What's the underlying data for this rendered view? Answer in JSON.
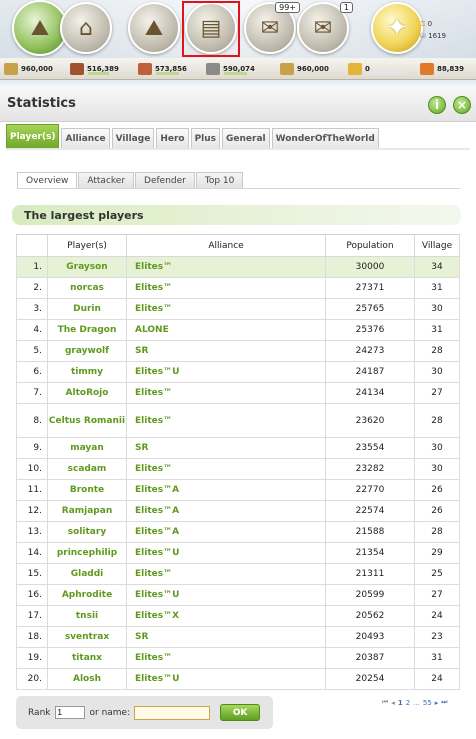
{
  "topbar": {
    "icons": [
      "village-overview-icon",
      "buildings-icon",
      "map-icon",
      "statistics-icon",
      "reports-icon",
      "messages-icon",
      "gold-icon"
    ],
    "reports_badge": "99+",
    "messages_badge": "1",
    "gold": "0",
    "silver": "1619"
  },
  "resources": {
    "culture": "960,000",
    "wood": "516,389",
    "clay": "573,856",
    "iron": "590,074",
    "crop_storage": "960,000",
    "free_crop": "0",
    "crop_prod": "88,839",
    "wood_fill": 0.54,
    "clay_fill": 0.6,
    "iron_fill": 0.61,
    "free_crop_fill": 0.0,
    "colors": {
      "wood": "#a0522d",
      "clay": "#c0603a",
      "iron": "#8a8a8a",
      "crop": "#e2b43a"
    }
  },
  "window": {
    "title": "Statistics",
    "help_label": "i",
    "close_label": "×",
    "tabs": [
      "Player(s)",
      "Alliance",
      "Village",
      "Hero",
      "Plus",
      "General",
      "WonderOfTheWorld"
    ],
    "subtabs": [
      "Overview",
      "Attacker",
      "Defender",
      "Top 10"
    ],
    "section_title": "The largest players"
  },
  "table": {
    "headers": [
      "",
      "Player(s)",
      "Alliance",
      "Population",
      "Village"
    ],
    "rows": [
      {
        "rank": "1.",
        "player": "Grayson",
        "alliance": "Elites™",
        "pop": "30000",
        "villages": "34"
      },
      {
        "rank": "2.",
        "player": "norcas",
        "alliance": "Elites™",
        "pop": "27371",
        "villages": "31"
      },
      {
        "rank": "3.",
        "player": "Durin",
        "alliance": "Elites™",
        "pop": "25765",
        "villages": "30"
      },
      {
        "rank": "4.",
        "player": "The Dragon",
        "alliance": "ALONE",
        "pop": "25376",
        "villages": "31"
      },
      {
        "rank": "5.",
        "player": "graywolf",
        "alliance": "SR",
        "pop": "24273",
        "villages": "28"
      },
      {
        "rank": "6.",
        "player": "timmy",
        "alliance": "Elites™U",
        "pop": "24187",
        "villages": "30"
      },
      {
        "rank": "7.",
        "player": "AltoRojo",
        "alliance": "Elites™",
        "pop": "24134",
        "villages": "27"
      },
      {
        "rank": "8.",
        "player": "Celtus Romanii",
        "alliance": "Elites™",
        "pop": "23620",
        "villages": "28"
      },
      {
        "rank": "9.",
        "player": "mayan",
        "alliance": "SR",
        "pop": "23554",
        "villages": "30"
      },
      {
        "rank": "10.",
        "player": "scadam",
        "alliance": "Elites™",
        "pop": "23282",
        "villages": "30"
      },
      {
        "rank": "11.",
        "player": "Bronte",
        "alliance": "Elites™A",
        "pop": "22770",
        "villages": "26"
      },
      {
        "rank": "12.",
        "player": "Ramjapan",
        "alliance": "Elites™A",
        "pop": "22574",
        "villages": "26"
      },
      {
        "rank": "13.",
        "player": "solitary",
        "alliance": "Elites™A",
        "pop": "21588",
        "villages": "28"
      },
      {
        "rank": "14.",
        "player": "princephilip",
        "alliance": "Elites™U",
        "pop": "21354",
        "villages": "29"
      },
      {
        "rank": "15.",
        "player": "Gladdi",
        "alliance": "Elites™",
        "pop": "21311",
        "villages": "25"
      },
      {
        "rank": "16.",
        "player": "Aphrodite",
        "alliance": "Elites™U",
        "pop": "20599",
        "villages": "27"
      },
      {
        "rank": "17.",
        "player": "tnsii",
        "alliance": "Elites™X",
        "pop": "20562",
        "villages": "24"
      },
      {
        "rank": "18.",
        "player": "sventrax",
        "alliance": "SR",
        "pop": "20493",
        "villages": "23"
      },
      {
        "rank": "19.",
        "player": "titanx",
        "alliance": "Elites™",
        "pop": "20387",
        "villages": "31"
      },
      {
        "rank": "20.",
        "player": "Alosh",
        "alliance": "Elites™U",
        "pop": "20254",
        "villages": "24"
      }
    ]
  },
  "search": {
    "rank_label": "Rank",
    "rank_value": "1",
    "name_label": "or name:",
    "name_value": "",
    "ok_label": "OK"
  },
  "pager": {
    "first": "⏮",
    "prev": "◂",
    "page1": "1",
    "page2": "2",
    "ellipsis": "...",
    "last_page": "55",
    "next": "▸",
    "last": "⏭"
  }
}
